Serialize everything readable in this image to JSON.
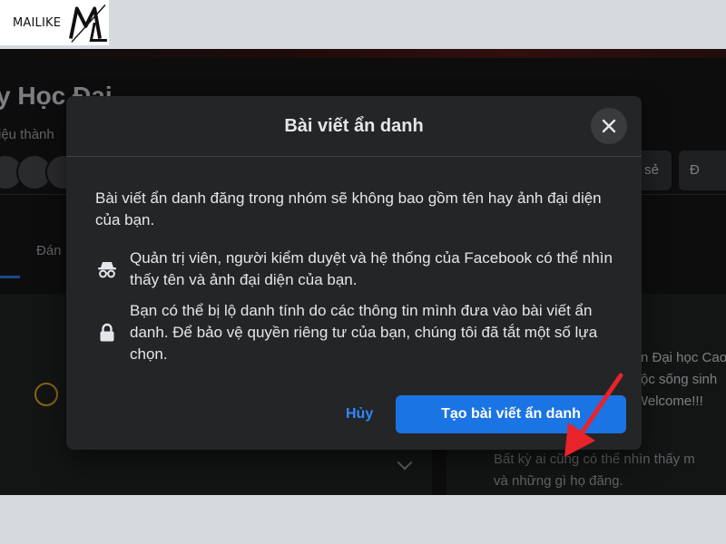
{
  "watermark": {
    "text": "MAILIKE",
    "logo_letters": "ML"
  },
  "background": {
    "group_title": "y Học Đại",
    "group_subtitle": "iệu thành",
    "tab_label": "Đán",
    "btn_share_label": "sẻ",
    "btn_right_label": "Đ",
    "right_panel_lines": [
      "n Đại học Cao",
      "ộc sống sinh",
      "Welcome!!!",
      "Bất kỳ ai cũng có thể nhìn thấy m",
      "và những gì họ đăng."
    ]
  },
  "modal": {
    "title": "Bài viết ẩn danh",
    "intro": "Bài viết ẩn danh đăng trong nhóm sẽ không bao gồm tên hay ảnh đại diện của bạn.",
    "items": [
      {
        "icon": "incognito-icon",
        "text": "Quản trị viên, người kiểm duyệt và hệ thống của Facebook có thể nhìn thấy tên và ảnh đại diện của bạn."
      },
      {
        "icon": "lock-icon",
        "text": "Bạn có thể bị lộ danh tính do các thông tin mình đưa vào bài viết ẩn danh. Để bảo vệ quyền riêng tư của bạn, chúng tôi đã tắt một số lựa chọn."
      }
    ],
    "cancel_label": "Hủy",
    "primary_label": "Tạo bài viết ẩn danh"
  },
  "colors": {
    "accent": "#1b74e4",
    "link": "#2d88ff",
    "annotation_arrow": "#e8232a",
    "modal_bg": "#242526"
  }
}
